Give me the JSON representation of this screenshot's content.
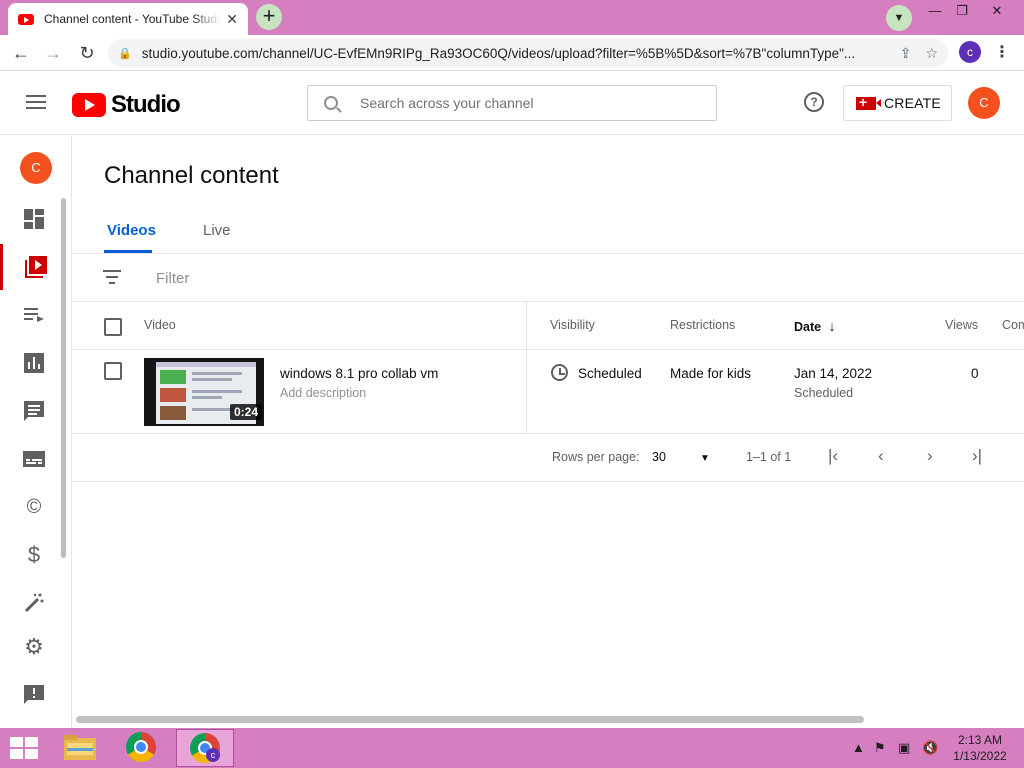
{
  "browser": {
    "tab_title": "Channel content - YouTube Studio",
    "tab_close": "✕",
    "new_tab": "+",
    "url": "studio.youtube.com/channel/UC-EvfEMn9RIPg_Ra93OC60Q/videos/upload?filter=%5B%5D&sort=%7B\"columnType\"...",
    "profile_letter": "c",
    "window_minimize": "—",
    "window_restore": "❐",
    "window_close": "✕"
  },
  "header": {
    "logo_text": "Studio",
    "search_placeholder": "Search across your channel",
    "help_label": "?",
    "create_label": "CREATE",
    "avatar_letter": "C"
  },
  "sidebar": {
    "avatar_letter": "C",
    "items": [
      {
        "name": "dashboard",
        "icon": "dashboard-icon"
      },
      {
        "name": "content",
        "icon": "content-icon",
        "active": true
      },
      {
        "name": "playlists",
        "icon": "playlist-icon"
      },
      {
        "name": "analytics",
        "icon": "analytics-icon"
      },
      {
        "name": "comments",
        "icon": "comments-icon"
      },
      {
        "name": "subtitles",
        "icon": "subtitles-icon"
      },
      {
        "name": "copyright",
        "icon": "copyright-icon",
        "glyph": "©"
      },
      {
        "name": "earn",
        "icon": "dollar-icon",
        "glyph": "$"
      },
      {
        "name": "customization",
        "icon": "magic-wand-icon"
      },
      {
        "name": "settings",
        "icon": "gear-icon"
      },
      {
        "name": "feedback",
        "icon": "feedback-icon",
        "glyph": "!"
      }
    ]
  },
  "main": {
    "page_title": "Channel content",
    "tabs": [
      {
        "label": "Videos",
        "active": true
      },
      {
        "label": "Live",
        "active": false
      }
    ],
    "filter_placeholder": "Filter",
    "columns": {
      "video": "Video",
      "visibility": "Visibility",
      "restrictions": "Restrictions",
      "date": "Date",
      "date_sort": "↓",
      "views": "Views",
      "comments": "Comments"
    },
    "rows": [
      {
        "duration": "0:24",
        "title": "windows 8.1 pro collab vm",
        "description": "Add description",
        "visibility": "Scheduled",
        "restrictions": "Made for kids",
        "date": "Jan 14, 2022",
        "date_status": "Scheduled",
        "views": "0"
      }
    ],
    "pagination": {
      "rows_per_page_label": "Rows per page:",
      "rows_per_page_value": "30",
      "range": "1–1 of 1",
      "first": "|‹",
      "prev": "‹",
      "next": "›",
      "last": "›|"
    }
  },
  "taskbar": {
    "time": "2:13 AM",
    "date": "1/13/2022",
    "apps": [
      "file-explorer",
      "chrome",
      "chrome-profile"
    ],
    "active_app_badge": "c"
  },
  "colors": {
    "accent_blue": "#065fd4",
    "brand_red": "#ff0000",
    "avatar_orange": "#f4511e",
    "frame_pink": "#d57ec0"
  }
}
